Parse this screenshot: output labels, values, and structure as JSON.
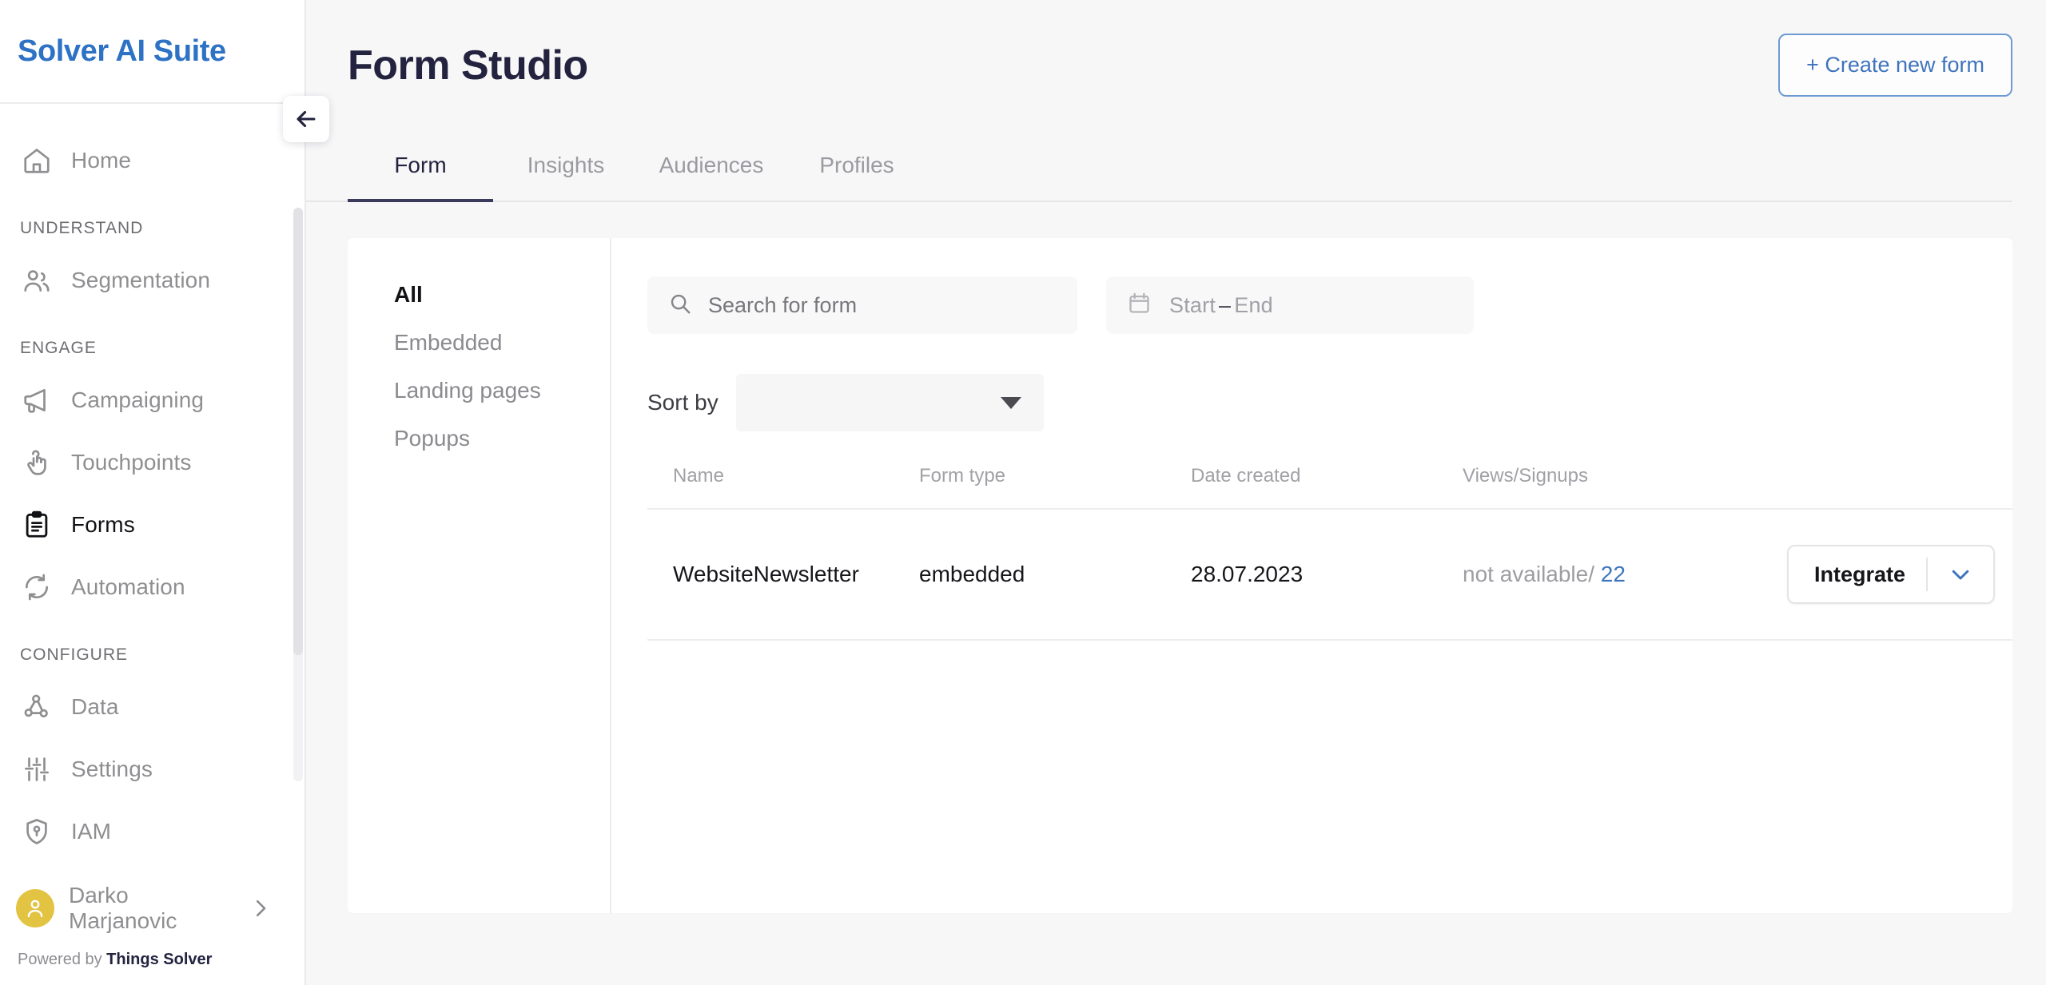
{
  "brand": {
    "name": "Solver AI Suite"
  },
  "sidebar": {
    "collapse_icon": "arrow-left-icon",
    "items": [
      {
        "label": "Home",
        "icon": "home-icon",
        "active": false
      },
      {
        "label": "Segmentation",
        "icon": "users-icon",
        "active": false
      },
      {
        "label": "Campaigning",
        "icon": "megaphone-icon",
        "active": false
      },
      {
        "label": "Touchpoints",
        "icon": "tap-icon",
        "active": false
      },
      {
        "label": "Forms",
        "icon": "clipboard-icon",
        "active": true
      },
      {
        "label": "Automation",
        "icon": "refresh-icon",
        "active": false
      },
      {
        "label": "Data",
        "icon": "nodes-icon",
        "active": false
      },
      {
        "label": "Settings",
        "icon": "sliders-icon",
        "active": false
      },
      {
        "label": "IAM",
        "icon": "shield-key-icon",
        "active": false
      }
    ],
    "sections": {
      "understand": "UNDERSTAND",
      "engage": "ENGAGE",
      "configure": "CONFIGURE"
    },
    "user": {
      "name": "Darko Marjanovic",
      "avatar_color": "#e3c342",
      "chevron_icon": "chevron-right-icon"
    },
    "footer": {
      "prefix": "Powered by ",
      "brand": "Things Solver"
    }
  },
  "header": {
    "title": "Form Studio",
    "create_button": "+ Create new form"
  },
  "tabs": [
    {
      "label": "Form",
      "active": true
    },
    {
      "label": "Insights",
      "active": false
    },
    {
      "label": "Audiences",
      "active": false
    },
    {
      "label": "Profiles",
      "active": false
    }
  ],
  "filters": [
    {
      "label": "All",
      "active": true
    },
    {
      "label": "Embedded",
      "active": false
    },
    {
      "label": "Landing pages",
      "active": false
    },
    {
      "label": "Popups",
      "active": false
    }
  ],
  "search": {
    "placeholder": "Search for form",
    "value": "",
    "icon": "search-icon"
  },
  "date_range": {
    "start": "Start",
    "separator": "–",
    "end": "End",
    "icon": "calendar-icon"
  },
  "sort": {
    "label": "Sort by",
    "value": "",
    "caret_icon": "caret-down-icon"
  },
  "table": {
    "columns": [
      "Name",
      "Form type",
      "Date created",
      "Views/Signups"
    ],
    "rows": [
      {
        "name": "WebsiteNewsletter",
        "form_type": "embedded",
        "date_created": "28.07.2023",
        "views": "not available/",
        "signups": "22",
        "action_label": "Integrate",
        "action_chevron_icon": "chevron-down-icon"
      }
    ]
  },
  "colors": {
    "brand_blue": "#2d72c4",
    "title_navy": "#23233f",
    "link_blue": "#3f74bd",
    "avatar_yellow": "#e3c342",
    "page_bg": "#f7f7f8"
  }
}
